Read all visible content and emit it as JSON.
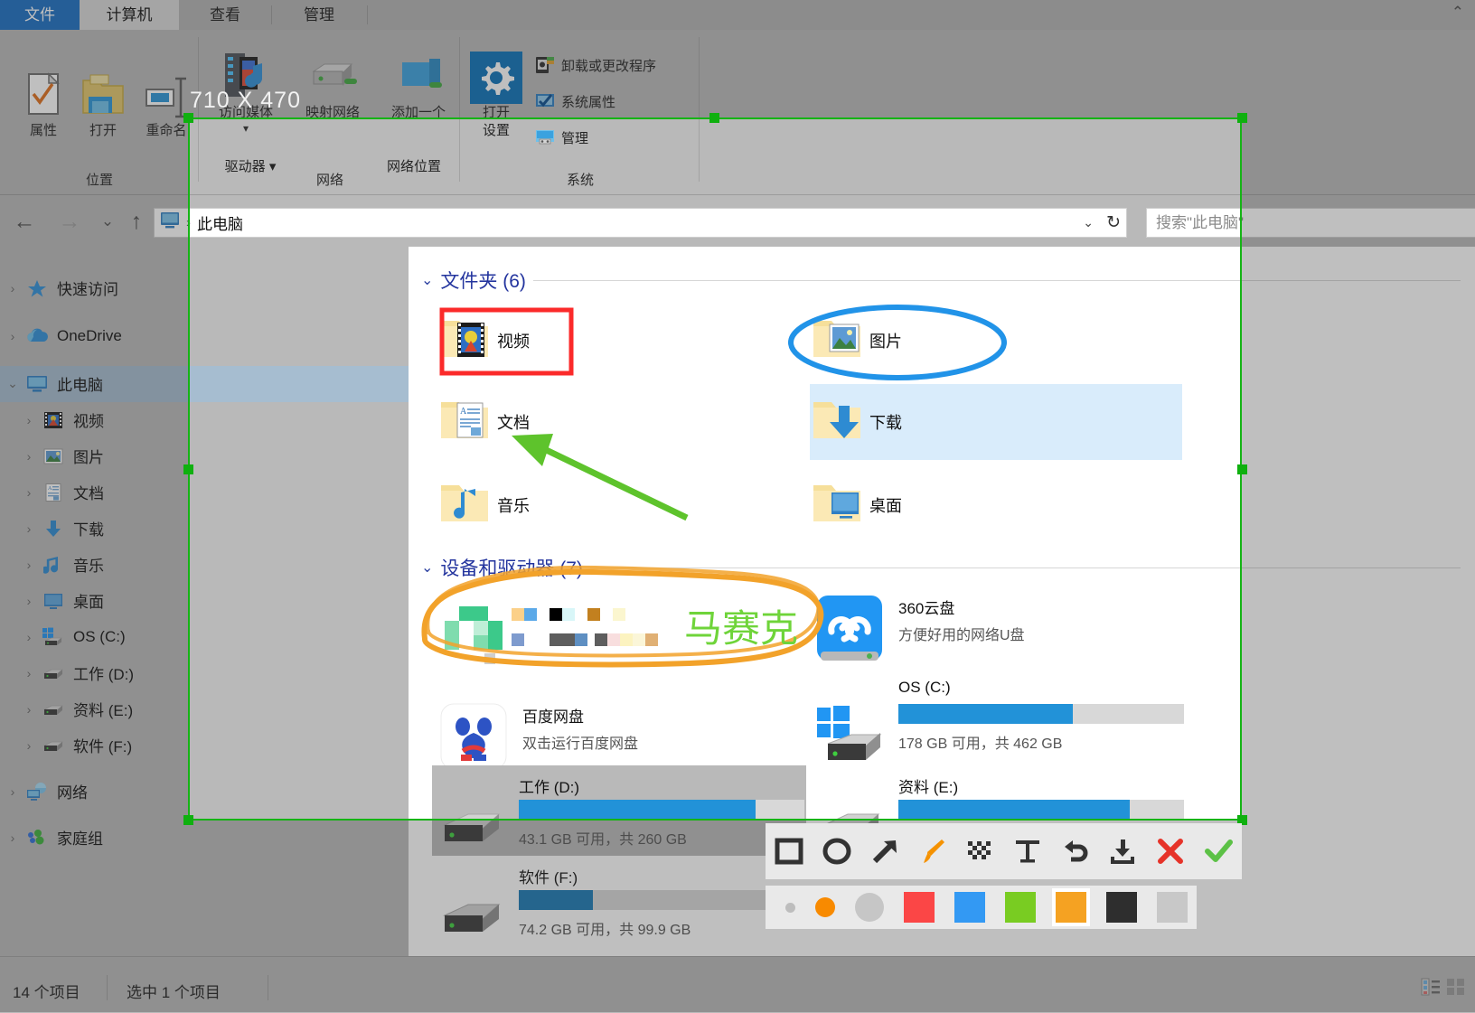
{
  "window": {
    "tabs": [
      {
        "label": "文件",
        "state": "file"
      },
      {
        "label": "计算机",
        "state": "active"
      },
      {
        "label": "查看",
        "state": "normal"
      },
      {
        "label": "管理",
        "state": "normal"
      }
    ]
  },
  "ribbon": {
    "groups": [
      {
        "label": "位置"
      },
      {
        "label": "网络"
      },
      {
        "label": "系统"
      }
    ],
    "location_buttons": [
      {
        "label": "属性",
        "icon": "properties-icon"
      },
      {
        "label": "打开",
        "icon": "open-folder-icon"
      },
      {
        "label": "重命名",
        "icon": "rename-icon"
      }
    ],
    "network_buttons": [
      {
        "label": "访问媒体",
        "icon": "media-server-icon",
        "sub": ""
      },
      {
        "label": "映射网络",
        "icon": "map-drive-icon",
        "sub": "驱动器"
      },
      {
        "label": "添加一个",
        "icon": "add-network-icon",
        "sub": "网络位置"
      }
    ],
    "system_big": {
      "line1": "打开",
      "line2": "设置",
      "icon": "gear-icon"
    },
    "system_small": [
      {
        "label": "卸载或更改程序",
        "icon": "uninstall-icon"
      },
      {
        "label": "系统属性",
        "icon": "system-properties-icon"
      },
      {
        "label": "管理",
        "icon": "manage-icon"
      }
    ]
  },
  "addressbar": {
    "back_icon": "back-arrow-icon",
    "forward_icon": "forward-arrow-icon",
    "history_icon": "chevron-down-icon",
    "up_icon": "up-arrow-icon",
    "crumb_icon": "this-pc-icon",
    "separator": "›",
    "crumb": "此电脑",
    "dropdown_icon": "chevron-down-icon",
    "refresh_icon": "refresh-icon",
    "search_placeholder": "搜索\"此电脑\""
  },
  "navpane": {
    "items": [
      {
        "label": "快速访问",
        "icon": "star-icon",
        "indent": 0,
        "expander": "›",
        "selected": false
      },
      {
        "label": "OneDrive",
        "icon": "onedrive-icon",
        "indent": 0,
        "expander": "›",
        "selected": false
      },
      {
        "label": "此电脑",
        "icon": "this-pc-icon",
        "indent": 0,
        "expander": "⌄",
        "selected": true
      },
      {
        "label": "视频",
        "icon": "videos-icon",
        "indent": 1,
        "expander": "›",
        "selected": false
      },
      {
        "label": "图片",
        "icon": "pictures-icon",
        "indent": 1,
        "expander": "›",
        "selected": false
      },
      {
        "label": "文档",
        "icon": "documents-icon",
        "indent": 1,
        "expander": "›",
        "selected": false
      },
      {
        "label": "下载",
        "icon": "downloads-icon",
        "indent": 1,
        "expander": "›",
        "selected": false
      },
      {
        "label": "音乐",
        "icon": "music-icon",
        "indent": 1,
        "expander": "›",
        "selected": false
      },
      {
        "label": "桌面",
        "icon": "desktop-icon",
        "indent": 1,
        "expander": "›",
        "selected": false
      },
      {
        "label": "OS (C:)",
        "icon": "os-drive-icon",
        "indent": 1,
        "expander": "›",
        "selected": false
      },
      {
        "label": "工作 (D:)",
        "icon": "drive-icon",
        "indent": 1,
        "expander": "›",
        "selected": false
      },
      {
        "label": "资料 (E:)",
        "icon": "drive-icon",
        "indent": 1,
        "expander": "›",
        "selected": false
      },
      {
        "label": "软件 (F:)",
        "icon": "drive-icon",
        "indent": 1,
        "expander": "›",
        "selected": false
      },
      {
        "label": "网络",
        "icon": "network-icon",
        "indent": 0,
        "expander": "›",
        "selected": false
      },
      {
        "label": "家庭组",
        "icon": "homegroup-icon",
        "indent": 0,
        "expander": "›",
        "selected": false
      }
    ]
  },
  "content": {
    "folders_group": {
      "title": "文件夹 (6)",
      "chevron": "⌄"
    },
    "folders": [
      {
        "label": "视频",
        "icon": "videos-folder-icon",
        "highlight": false
      },
      {
        "label": "图片",
        "icon": "pictures-folder-icon",
        "highlight": false
      },
      {
        "label": "文档",
        "icon": "documents-folder-icon",
        "highlight": false
      },
      {
        "label": "下载",
        "icon": "downloads-folder-icon",
        "highlight": true
      },
      {
        "label": "音乐",
        "icon": "music-folder-icon",
        "highlight": false
      },
      {
        "label": "桌面",
        "icon": "desktop-folder-icon",
        "highlight": false
      }
    ],
    "devices_group": {
      "title": "设备和驱动器 (7)",
      "chevron": "⌄"
    },
    "devices": [
      {
        "name": "",
        "sub": "",
        "icon": "mosaic-censored-icon",
        "kind": "app",
        "censored": true
      },
      {
        "name": "360云盘",
        "sub": "方便好用的网络U盘",
        "icon": "cloud360-icon",
        "kind": "app"
      },
      {
        "name": "百度网盘",
        "sub": "双击运行百度网盘",
        "icon": "baidunetdisk-icon",
        "kind": "app"
      },
      {
        "name": "OS (C:)",
        "sub": "178 GB 可用，共 462 GB",
        "icon": "windows-drive-icon",
        "kind": "drive",
        "used_pct": 61,
        "selected": false
      },
      {
        "name": "工作 (D:)",
        "sub": "43.1 GB 可用，共 260 GB",
        "icon": "drive-icon",
        "kind": "drive",
        "used_pct": 83,
        "selected": true
      },
      {
        "name": "资料 (E:)",
        "sub": "",
        "icon": "drive-icon",
        "kind": "drive",
        "used_pct": 81,
        "selected": false
      },
      {
        "name": "软件 (F:)",
        "sub": "74.2 GB 可用，共 99.9 GB",
        "icon": "drive-icon",
        "kind": "drive",
        "used_pct": 26,
        "selected": false
      }
    ]
  },
  "statusbar": {
    "item_count": "14 个项目",
    "selection": "选中 1 个项目",
    "view_details_icon": "details-view-icon",
    "view_large_icon": "large-icons-view-icon"
  },
  "capture": {
    "size_label": "710 X 470",
    "selection_color": "#15b415",
    "handle_color": "#0fb00f"
  },
  "annotations": {
    "red_box_target": "视频",
    "blue_ellipse_target": "图片",
    "green_arrow_target": "文档",
    "orange_scribble_target": "mosaic-censored-icon",
    "green_text": "马赛克"
  },
  "anno_toolbar": {
    "tools": [
      {
        "name": "rectangle-tool",
        "glyph": "▭",
        "color": "#333333"
      },
      {
        "name": "ellipse-tool",
        "glyph": "◯",
        "color": "#333333"
      },
      {
        "name": "arrow-tool",
        "glyph": "↗",
        "color": "#333333"
      },
      {
        "name": "brush-tool",
        "glyph": "brush",
        "color": "#f59200"
      },
      {
        "name": "mosaic-tool",
        "glyph": "mosaic",
        "color": "#333333"
      },
      {
        "name": "text-tool",
        "glyph": "T",
        "color": "#333333"
      },
      {
        "name": "undo-tool",
        "glyph": "↺",
        "color": "#333333"
      },
      {
        "name": "save-tool",
        "glyph": "download",
        "color": "#333333"
      },
      {
        "name": "cancel-tool",
        "glyph": "✕",
        "color": "#e63329"
      },
      {
        "name": "confirm-tool",
        "glyph": "✓",
        "color": "#5cc146"
      }
    ],
    "palette": [
      {
        "name": "size-small-swatch",
        "color": "#bdbdbd",
        "shape": "circle",
        "size": 11,
        "selected": false
      },
      {
        "name": "size-medium-swatch",
        "color": "#f88a00",
        "shape": "circle",
        "size": 22,
        "selected": false
      },
      {
        "name": "size-large-swatch",
        "color": "#c6c6c6",
        "shape": "circle",
        "size": 32,
        "selected": false
      },
      {
        "name": "color-red-swatch",
        "color": "#fb4646",
        "shape": "square",
        "size": 34,
        "selected": false
      },
      {
        "name": "color-blue-swatch",
        "color": "#3399f3",
        "shape": "square",
        "size": 34,
        "selected": false
      },
      {
        "name": "color-green-swatch",
        "color": "#79cc22",
        "shape": "square",
        "size": 34,
        "selected": false
      },
      {
        "name": "color-orange-swatch",
        "color": "#f5a222",
        "shape": "square",
        "size": 34,
        "selected": true
      },
      {
        "name": "color-black-swatch",
        "color": "#2e2e2e",
        "shape": "square",
        "size": 34,
        "selected": false
      },
      {
        "name": "color-gray-swatch",
        "color": "#c8c8c8",
        "shape": "square",
        "size": 34,
        "selected": false
      }
    ]
  }
}
